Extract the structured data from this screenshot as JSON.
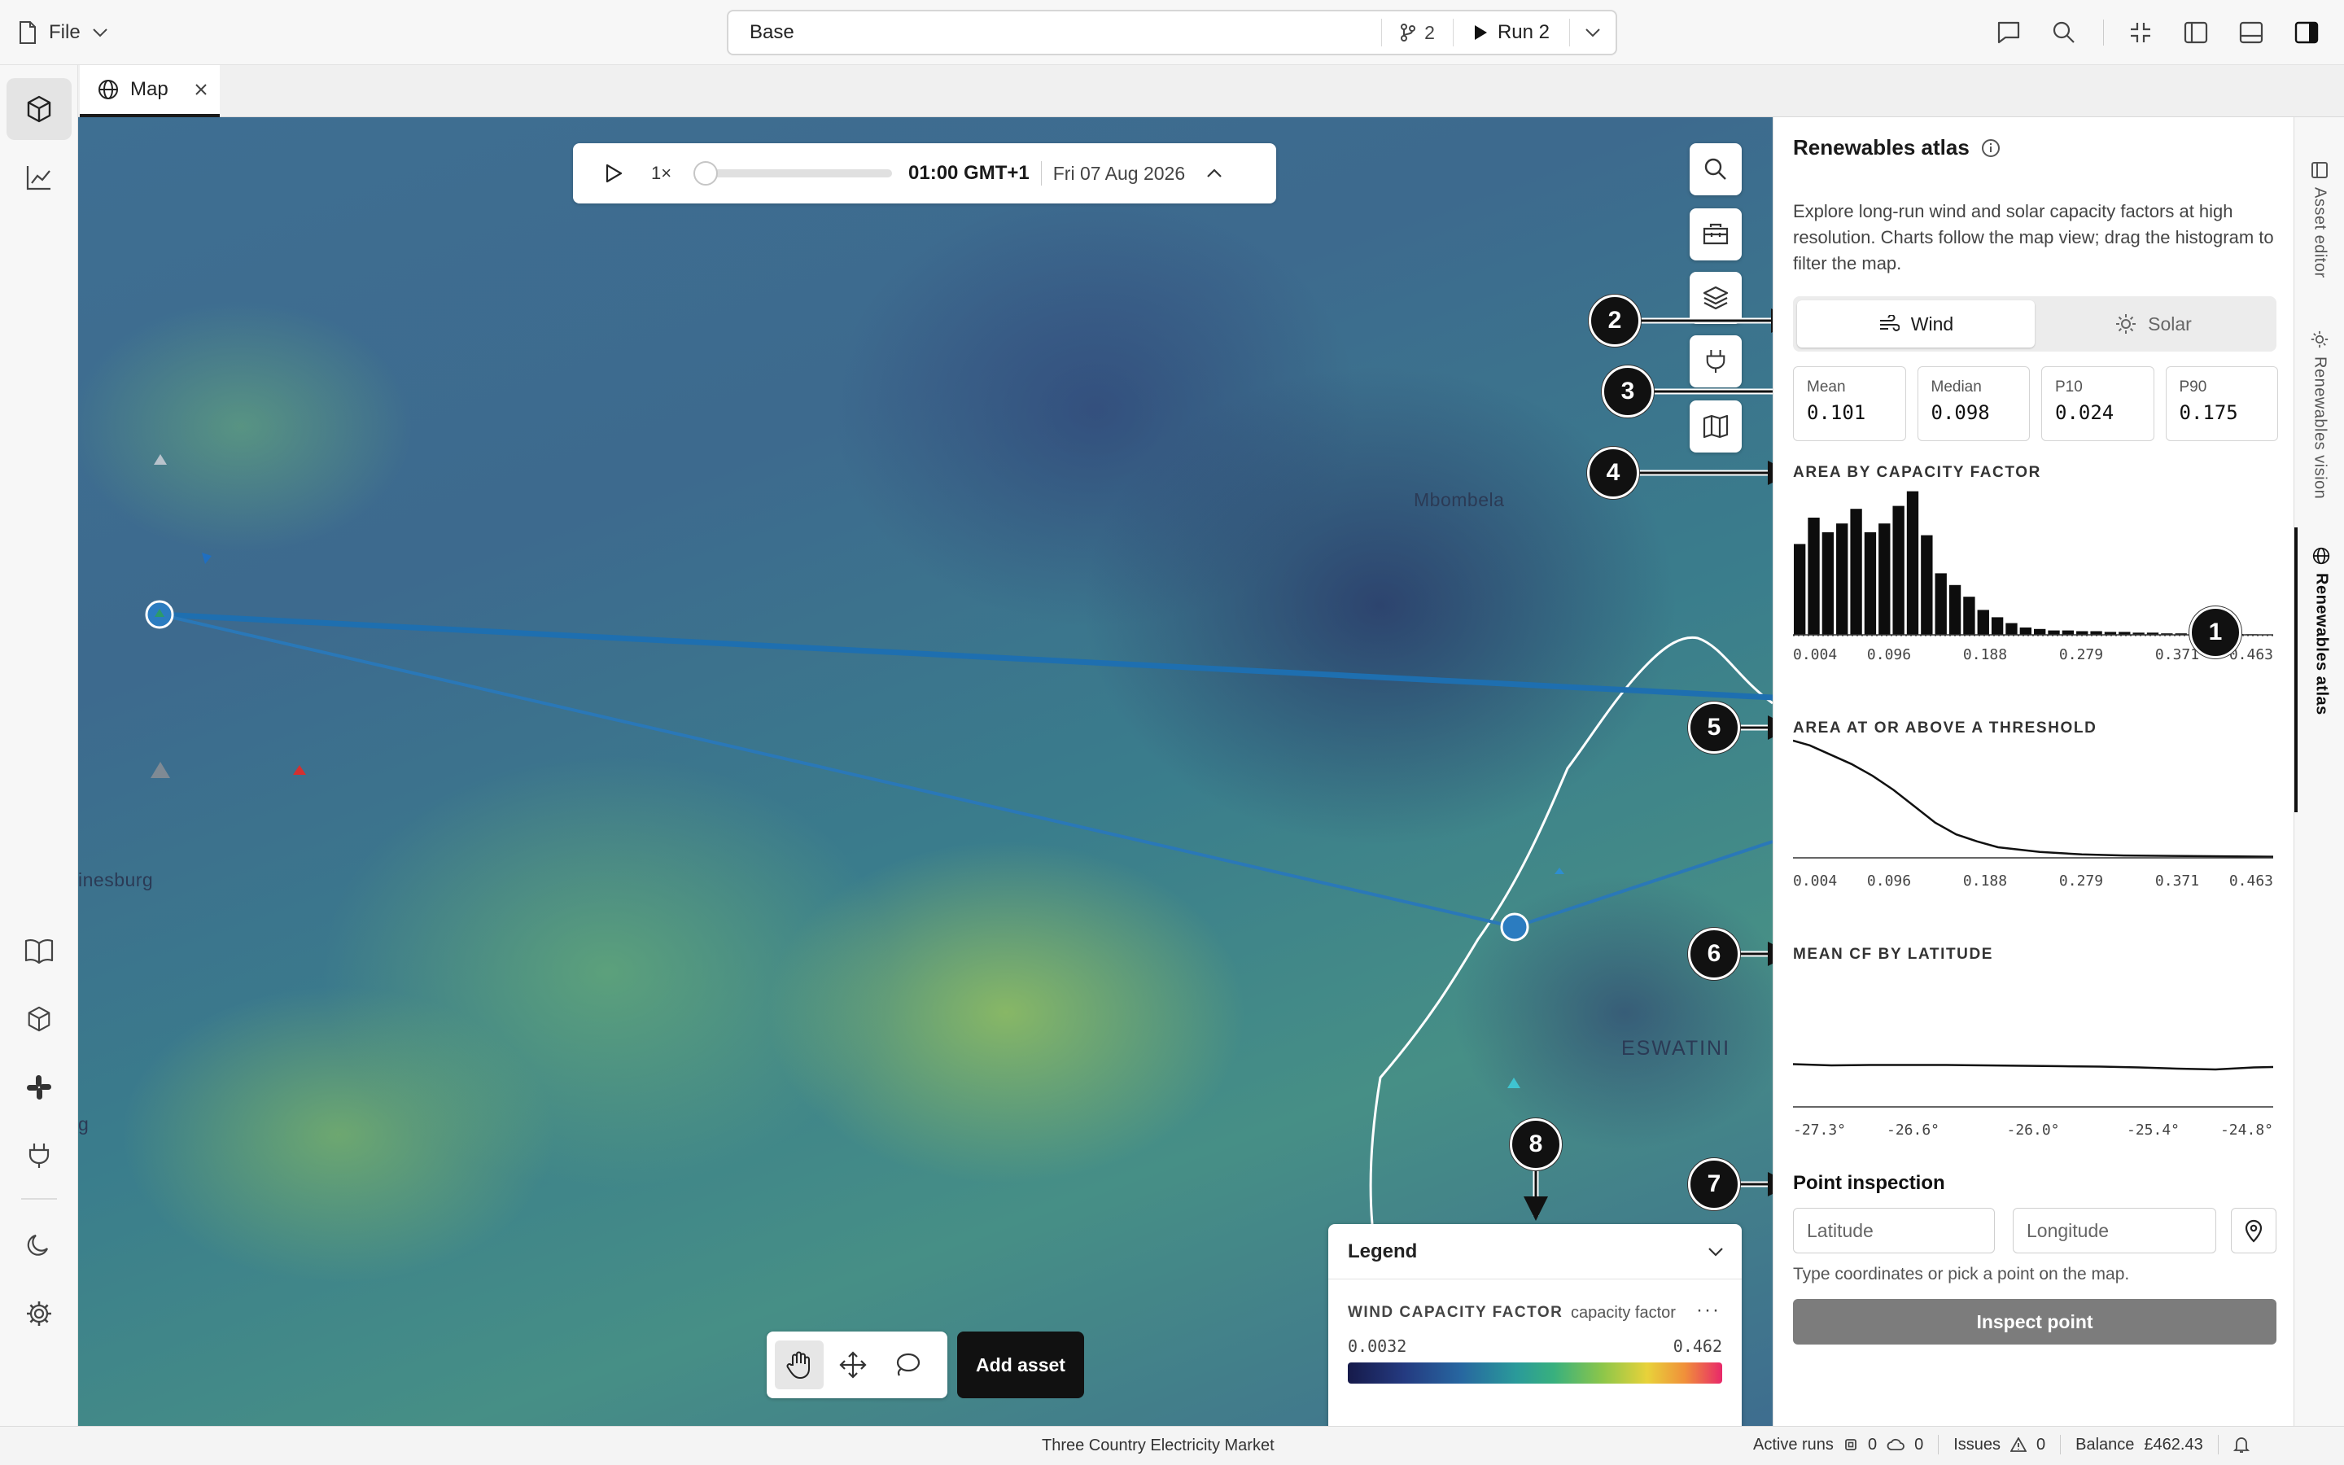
{
  "topbar": {
    "file_label": "File",
    "scenario_title": "Base",
    "branch_count": "2",
    "run_label": "Run 2"
  },
  "tabs": [
    {
      "label": "Map"
    }
  ],
  "map": {
    "labels": {
      "city_1": "Mbombela",
      "city_2": "Johannesburg_partial",
      "country": "ESWATINI",
      "city_2_text": "inesburg",
      "edge_letter": "g"
    },
    "timebar": {
      "speed": "1×",
      "time": "01:00 GMT+1",
      "date": "Fri 07 Aug 2026",
      "progress": 0.0
    },
    "add_asset_label": "Add asset"
  },
  "legend": {
    "title": "Legend",
    "variable": "WIND CAPACITY FACTOR",
    "unit": "capacity factor",
    "min": "0.0032",
    "max": "0.462"
  },
  "callouts": [
    "1",
    "2",
    "3",
    "4",
    "5",
    "6",
    "7",
    "8"
  ],
  "panel": {
    "title": "Renewables atlas",
    "description": "Explore long-run wind and solar capacity factors at high resolution. Charts follow the map view; drag the histogram to filter the map.",
    "modes": [
      {
        "label": "Wind",
        "active": true
      },
      {
        "label": "Solar",
        "active": false
      }
    ],
    "stats": [
      {
        "label": "Mean",
        "value": "0.101"
      },
      {
        "label": "Median",
        "value": "0.098"
      },
      {
        "label": "P10",
        "value": "0.024"
      },
      {
        "label": "P90",
        "value": "0.175"
      }
    ],
    "section_histogram": "AREA BY CAPACITY FACTOR",
    "section_threshold": "AREA AT OR ABOVE A THRESHOLD",
    "section_latitude": "MEAN CF BY LATITUDE",
    "point_inspection": {
      "title": "Point inspection",
      "lat_placeholder": "Latitude",
      "lon_placeholder": "Longitude",
      "hint": "Type coordinates or pick a point on the map.",
      "button": "Inspect point"
    }
  },
  "chart_data": [
    {
      "type": "bar",
      "x_ticks": [
        "0.004",
        "0.096",
        "0.188",
        "0.279",
        "0.371",
        "0.463"
      ],
      "xlim": [
        0.004,
        0.463
      ],
      "values": [
        62,
        80,
        70,
        76,
        86,
        70,
        76,
        88,
        98,
        68,
        42,
        34,
        26,
        17,
        12,
        8,
        5,
        4,
        3,
        3,
        2.5,
        2.5,
        2,
        2,
        1.5,
        1.5,
        1,
        1,
        1,
        1,
        0.8,
        0.6,
        0.4,
        0.2
      ],
      "ylim": [
        0,
        100
      ]
    },
    {
      "type": "line",
      "x_ticks": [
        "0.004",
        "0.096",
        "0.188",
        "0.279",
        "0.371",
        "0.463"
      ],
      "xlim": [
        0.004,
        0.463
      ],
      "x": [
        0.004,
        0.02,
        0.04,
        0.06,
        0.08,
        0.1,
        0.12,
        0.14,
        0.16,
        0.18,
        0.2,
        0.24,
        0.28,
        0.32,
        0.38,
        0.463
      ],
      "y": [
        100,
        96,
        88,
        80,
        70,
        58,
        44,
        30,
        20,
        14,
        9,
        5,
        3,
        2,
        1.5,
        1
      ],
      "ylim": [
        0,
        100
      ]
    },
    {
      "type": "line",
      "x_ticks": [
        "-27.3°",
        "-26.6°",
        "-26.0°",
        "-25.4°",
        "-24.8°"
      ],
      "xlim": [
        -27.3,
        -24.8
      ],
      "x": [
        -27.3,
        -27.1,
        -26.9,
        -26.7,
        -26.5,
        -26.3,
        -26.1,
        -25.9,
        -25.7,
        -25.5,
        -25.3,
        -25.1,
        -24.9,
        -24.8
      ],
      "y": [
        0.105,
        0.102,
        0.103,
        0.103,
        0.103,
        0.102,
        0.101,
        0.1,
        0.099,
        0.097,
        0.094,
        0.092,
        0.097,
        0.098
      ],
      "ylim": [
        0,
        0.3
      ]
    }
  ]
}
